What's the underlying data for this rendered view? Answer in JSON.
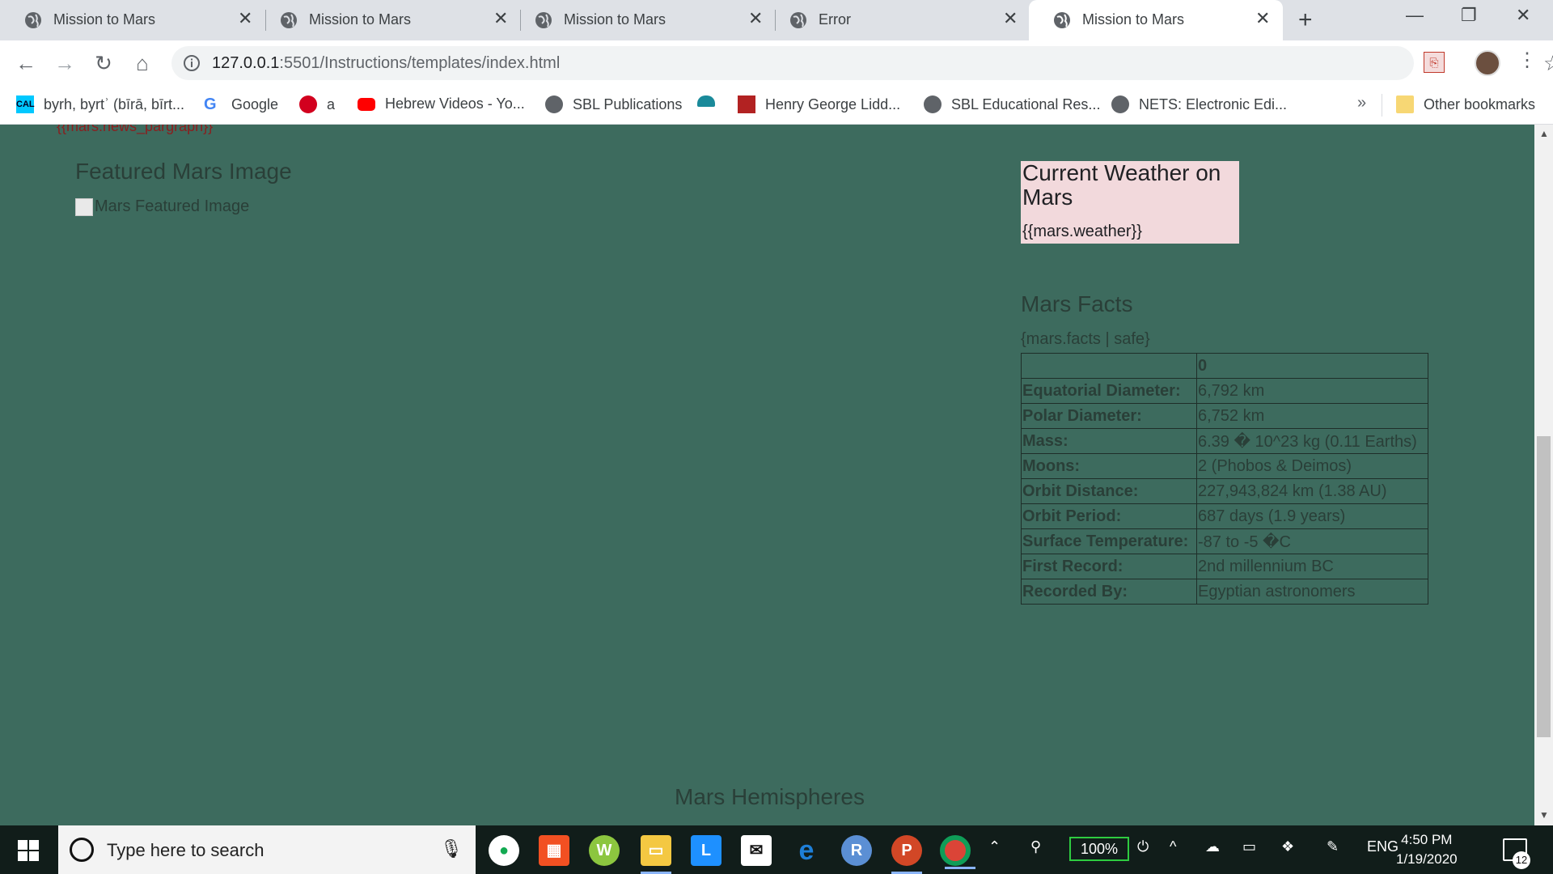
{
  "tabs": [
    {
      "title": "Mission to Mars",
      "active": false
    },
    {
      "title": "Mission to Mars",
      "active": false
    },
    {
      "title": "Mission to Mars",
      "active": false
    },
    {
      "title": "Error",
      "active": false
    },
    {
      "title": "Mission to Mars",
      "active": true
    }
  ],
  "address": {
    "host": "127.0.0.1",
    "path": ":5501/Instructions/templates/index.html"
  },
  "bookmarks": [
    "byrh, byrtʾ (bīrā, bīrt...",
    "Google",
    "a",
    "Hebrew Videos - Yo...",
    "SBL Publications",
    "",
    "Henry George Lidd...",
    "SBL Educational Res...",
    "NETS: Electronic Edi...",
    "Other bookmarks"
  ],
  "bookmark_chevron": "»",
  "page": {
    "news_paragraph": "{{mars.news_pargraph}}",
    "featured_title": "Featured Mars Image",
    "featured_alt": "Mars Featured Image",
    "weather_title": "Current Weather on Mars",
    "weather_value": "{{mars.weather}}",
    "facts_title": "Mars Facts",
    "facts_template": "{mars.facts | safe}",
    "facts_header": "0",
    "facts": [
      {
        "label": "Equatorial Diameter:",
        "value": "6,792 km"
      },
      {
        "label": "Polar Diameter:",
        "value": "6,752 km"
      },
      {
        "label": "Mass:",
        "value": "6.39 � 10^23 kg (0.11 Earths)"
      },
      {
        "label": "Moons:",
        "value": "2 (Phobos & Deimos)"
      },
      {
        "label": "Orbit Distance:",
        "value": "227,943,824 km (1.38 AU)"
      },
      {
        "label": "Orbit Period:",
        "value": "687 days (1.9 years)"
      },
      {
        "label": "Surface Temperature:",
        "value": "-87 to -5 �C"
      },
      {
        "label": "First Record:",
        "value": "2nd millennium BC"
      },
      {
        "label": "Recorded By:",
        "value": "Egyptian astronomers"
      }
    ],
    "hemispheres_title": "Mars Hemispheres"
  },
  "taskbar": {
    "search_placeholder": "Type here to search",
    "battery": "100%",
    "language": "ENG",
    "time": "4:50 PM",
    "date": "1/19/2020",
    "notifications": "12"
  }
}
